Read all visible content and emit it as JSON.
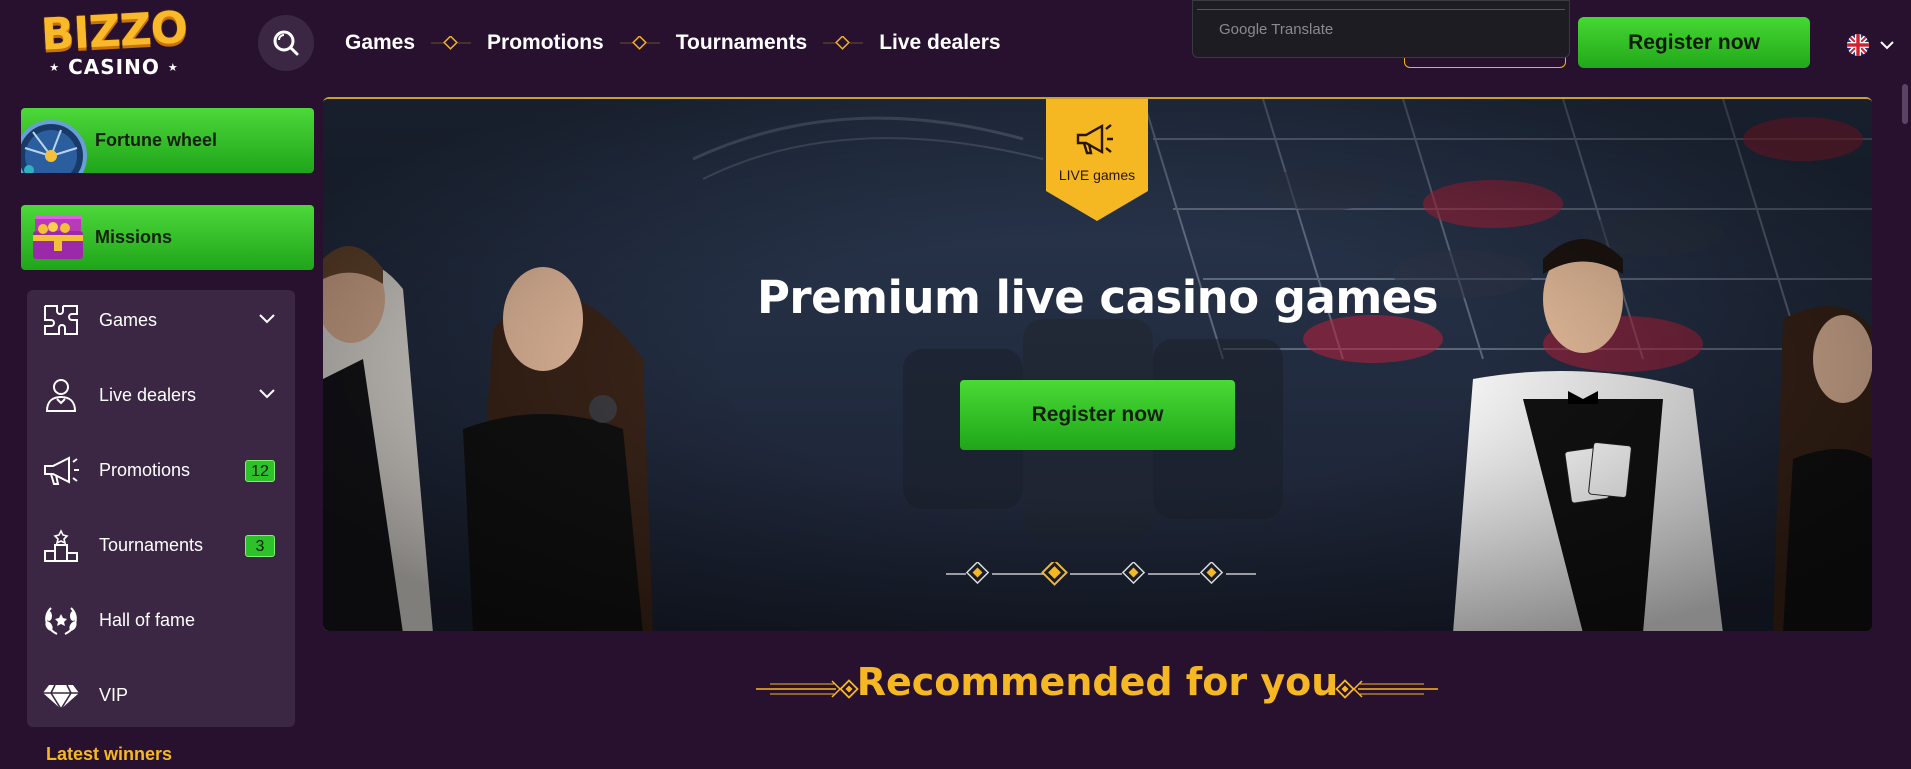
{
  "header": {
    "logo_top": "BIZZO",
    "logo_bottom": "CASINO",
    "nav": [
      {
        "label": "Games"
      },
      {
        "label": "Promotions"
      },
      {
        "label": "Tournaments"
      },
      {
        "label": "Live dealers"
      }
    ],
    "translate_label": "Google Translate",
    "register_label": "Register now",
    "language_icon": "uk-flag-icon"
  },
  "sidebar": {
    "promos": [
      {
        "label": "Fortune wheel",
        "icon": "fortune-wheel-icon"
      },
      {
        "label": "Missions",
        "icon": "treasure-chest-icon"
      }
    ],
    "menu": [
      {
        "label": "Games",
        "icon": "puzzle-icon",
        "expandable": true
      },
      {
        "label": "Live dealers",
        "icon": "dealer-icon",
        "expandable": true
      },
      {
        "label": "Promotions",
        "icon": "megaphone-icon",
        "badge": "12"
      },
      {
        "label": "Tournaments",
        "icon": "podium-icon",
        "badge": "3"
      },
      {
        "label": "Hall of fame",
        "icon": "laurel-icon"
      },
      {
        "label": "VIP",
        "icon": "diamond-icon"
      }
    ],
    "latest_winners": "Latest winners"
  },
  "hero": {
    "tag_label": "LIVE games",
    "title": "Premium live casino games",
    "register_label": "Register now",
    "slides_total": 4,
    "active_slide": 2
  },
  "recommended": {
    "title": "Recommended for you"
  },
  "colors": {
    "background": "#27112f",
    "panel": "#3b2644",
    "accent_green": "#2ec22a",
    "accent_gold": "#f6b822"
  }
}
